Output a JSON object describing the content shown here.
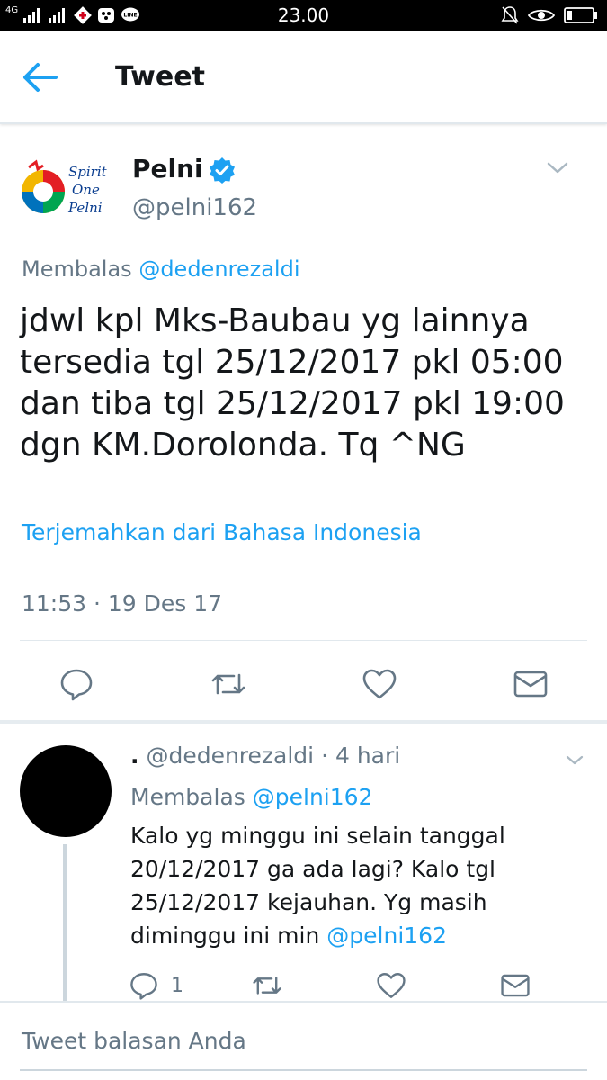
{
  "status_bar": {
    "network_label": "4G",
    "time": "23.00"
  },
  "header": {
    "title": "Tweet"
  },
  "tweet": {
    "author_name": "Pelni",
    "author_handle": "@pelni162",
    "avatar_icon": "pelni-spirit-one-pelni-logo",
    "reply_label": "Membalas",
    "reply_mention": "@dedenrezaldi",
    "text_lines": [
      "jdwl kpl Mks-Baubau yg lainnya",
      "tersedia tgl 25/12/2017 pkl 05:00",
      "dan tiba tgl 25/12/2017 pkl 19:00",
      "dgn KM.Dorolonda. Tq ^NG"
    ],
    "translate_link": "Terjemahkan dari Bahasa Indonesia",
    "timestamp": "11:53 · 19 Des 17",
    "actions": [
      "reply-icon",
      "retweet-icon",
      "like-icon",
      "direct-message-icon"
    ]
  },
  "reply": {
    "name": ".",
    "handle": "@dedenrezaldi",
    "time_sep": "·",
    "time": "4 hari",
    "reply_label": "Membalas",
    "reply_mention": "@pelni162",
    "text_lines": [
      "Kalo yg minggu ini selain tanggal",
      "20/12/2017 ga ada lagi?  Kalo tgl",
      "25/12/2017 kejauhan.  Yg masih"
    ],
    "last_line_text": "diminggu ini min",
    "last_line_mention": "@pelni162",
    "reply_count": "1"
  },
  "compose": {
    "placeholder": "Tweet balasan Anda"
  },
  "colors": {
    "accent": "#1da1f2",
    "secondary_text": "#657786",
    "primary_text": "#14171a",
    "divider": "#e1e8ed"
  }
}
